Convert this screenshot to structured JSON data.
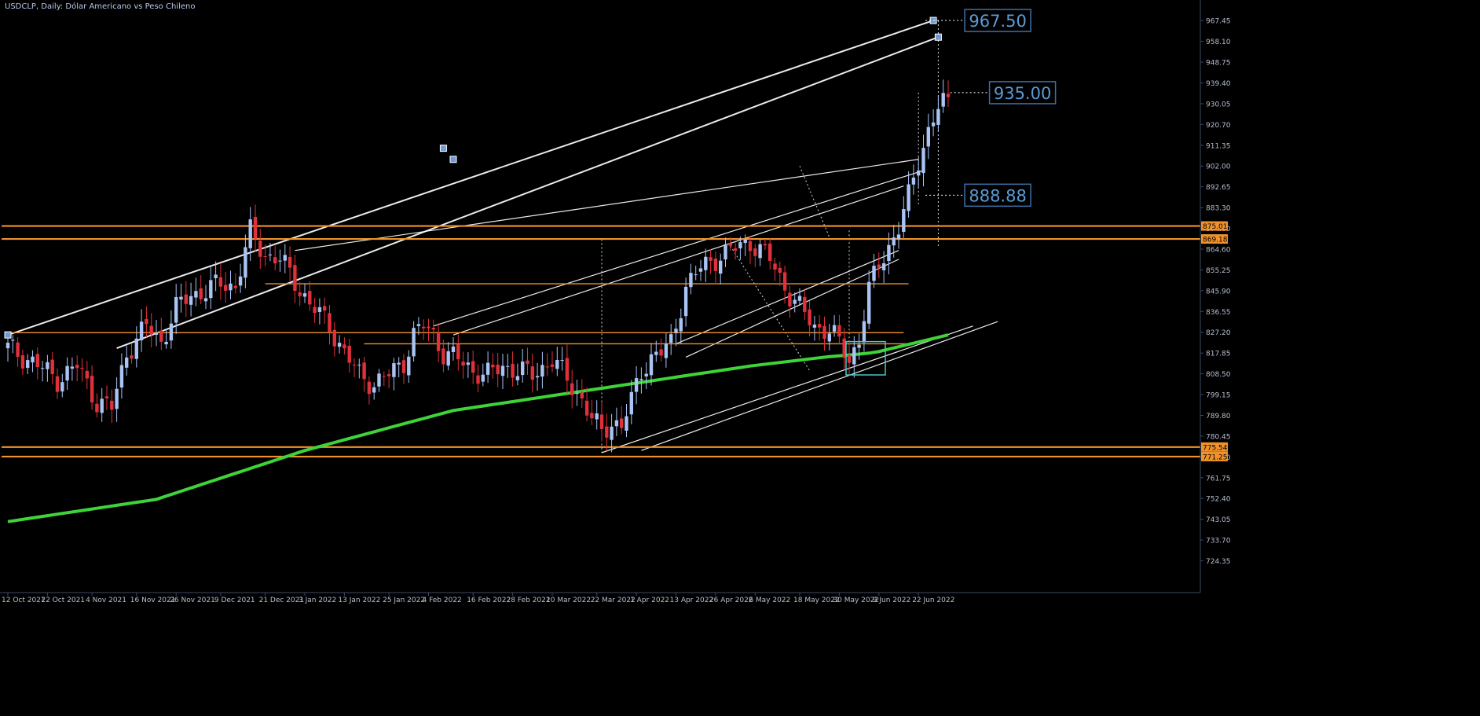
{
  "header": {
    "title": "USDCLP, Daily:  Dólar Americano vs Peso Chileno"
  },
  "colors": {
    "background": "#000000",
    "bull_candle": "#a9c4f5",
    "bear_candle": "#e0313b",
    "moving_average": "#3fd33a",
    "support_resistance": "#f0922b",
    "trend_lines": "#ffffff",
    "price_label_border": "#3f6fa8",
    "price_label_text": "#5b9bd5",
    "axis_text": "#b7bfcf",
    "axis_line": "#3c4a66",
    "selection_box": "#47c9c1"
  },
  "chart_data": {
    "type": "candlestick",
    "title": "USDCLP, Daily:  Dólar Americano vs Peso Chileno",
    "ylim": [
      715.0,
      976.0
    ],
    "grid": false,
    "y_ticks": [
      "967.45",
      "958.10",
      "948.75",
      "939.40",
      "930.05",
      "920.70",
      "911.35",
      "902.00",
      "892.65",
      "883.30",
      "874.00",
      "864.60",
      "855.25",
      "845.90",
      "836.55",
      "827.20",
      "817.85",
      "808.50",
      "799.15",
      "789.80",
      "780.45",
      "771.10",
      "761.75",
      "752.40",
      "743.05",
      "733.70",
      "724.35"
    ],
    "x_ticks": [
      {
        "label": "12 Oct 2021",
        "bar": 0
      },
      {
        "label": "22 Oct 2021",
        "bar": 8
      },
      {
        "label": "4 Nov 2021",
        "bar": 17
      },
      {
        "label": "16 Nov 2021",
        "bar": 26
      },
      {
        "label": "26 Nov 2021",
        "bar": 34
      },
      {
        "label": "9 Dec 2021",
        "bar": 43
      },
      {
        "label": "21 Dec 2021",
        "bar": 52
      },
      {
        "label": "3 Jan 2022",
        "bar": 60
      },
      {
        "label": "13 Jan 2022",
        "bar": 68
      },
      {
        "label": "25 Jan 2022",
        "bar": 77
      },
      {
        "label": "4 Feb 2022",
        "bar": 85
      },
      {
        "label": "16 Feb 2022",
        "bar": 94
      },
      {
        "label": "28 Feb 2022",
        "bar": 102
      },
      {
        "label": "10 Mar 2022",
        "bar": 110
      },
      {
        "label": "22 Mar 2022",
        "bar": 119
      },
      {
        "label": "1 Apr 2022",
        "bar": 127
      },
      {
        "label": "13 Apr 2022",
        "bar": 135
      },
      {
        "label": "26 Apr 2022",
        "bar": 143
      },
      {
        "label": "6 May 2022",
        "bar": 151
      },
      {
        "label": "18 May 2022",
        "bar": 160
      },
      {
        "label": "30 May 2022",
        "bar": 168
      },
      {
        "label": "9 Jun 2022",
        "bar": 176
      },
      {
        "label": "22 Jun 2022",
        "bar": 184
      }
    ],
    "anchors": [
      [
        0,
        820
      ],
      [
        5,
        814
      ],
      [
        10,
        806
      ],
      [
        14,
        812
      ],
      [
        18,
        796
      ],
      [
        21,
        793
      ],
      [
        24,
        818
      ],
      [
        28,
        830
      ],
      [
        31,
        823
      ],
      [
        34,
        838
      ],
      [
        37,
        844
      ],
      [
        40,
        846
      ],
      [
        43,
        849
      ],
      [
        46,
        848
      ],
      [
        49,
        872
      ],
      [
        52,
        862
      ],
      [
        55,
        860
      ],
      [
        58,
        850
      ],
      [
        61,
        840
      ],
      [
        65,
        830
      ],
      [
        68,
        818
      ],
      [
        71,
        808
      ],
      [
        74,
        804
      ],
      [
        77,
        808
      ],
      [
        80,
        814
      ],
      [
        82,
        826
      ],
      [
        84,
        830
      ],
      [
        86,
        826
      ],
      [
        88,
        818
      ],
      [
        91,
        815
      ],
      [
        94,
        810
      ],
      [
        97,
        808
      ],
      [
        100,
        812
      ],
      [
        103,
        810
      ],
      [
        106,
        808
      ],
      [
        110,
        815
      ],
      [
        113,
        806
      ],
      [
        116,
        797
      ],
      [
        118,
        788
      ],
      [
        120,
        782
      ],
      [
        122,
        787
      ],
      [
        124,
        785
      ],
      [
        126,
        796
      ],
      [
        128,
        810
      ],
      [
        130,
        816
      ],
      [
        132,
        818
      ],
      [
        134,
        822
      ],
      [
        137,
        848
      ],
      [
        140,
        856
      ],
      [
        144,
        862
      ],
      [
        148,
        866
      ],
      [
        150,
        868
      ],
      [
        152,
        864
      ],
      [
        154,
        860
      ],
      [
        156,
        852
      ],
      [
        158,
        844
      ],
      [
        160,
        838
      ],
      [
        163,
        830
      ],
      [
        166,
        828
      ],
      [
        168,
        822
      ],
      [
        170,
        815
      ],
      [
        172,
        824
      ],
      [
        174,
        846
      ],
      [
        176,
        858
      ],
      [
        178,
        866
      ],
      [
        180,
        874
      ],
      [
        182,
        888
      ],
      [
        184,
        905
      ],
      [
        186,
        918
      ],
      [
        188,
        928
      ],
      [
        190,
        932
      ]
    ],
    "last_price": 935.0,
    "moving_average": {
      "anchors": [
        [
          0,
          742
        ],
        [
          30,
          752
        ],
        [
          60,
          774
        ],
        [
          90,
          792
        ],
        [
          120,
          802
        ],
        [
          150,
          812
        ],
        [
          165,
          816
        ],
        [
          175,
          818
        ],
        [
          190,
          826
        ]
      ]
    },
    "horizontal_levels": [
      {
        "price": 875.01,
        "label": "875.01",
        "full": true
      },
      {
        "price": 869.18,
        "label": "869.18",
        "full": true
      },
      {
        "price": 775.54,
        "label": "775.54",
        "full": true
      },
      {
        "price": 771.25,
        "label": "771.25",
        "full": true
      },
      {
        "price": 849.0,
        "from_bar": 52,
        "to_bar": 182
      },
      {
        "price": 827.0,
        "from_bar": 0,
        "to_bar": 181
      },
      {
        "price": 822.0,
        "from_bar": 72,
        "to_bar": 182
      }
    ],
    "price_labels": [
      {
        "text": "967.50",
        "price": 967.5,
        "bar": 187
      },
      {
        "text": "935.00",
        "price": 935.0,
        "bar": 192
      },
      {
        "text": "888.88",
        "price": 888.88,
        "bar": 187
      }
    ],
    "levels_axis": [
      "875.01",
      "869.18",
      "775.54",
      "771.25"
    ]
  }
}
